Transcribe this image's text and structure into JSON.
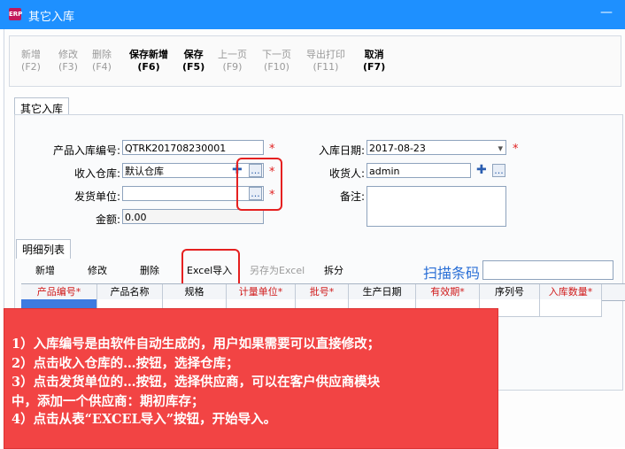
{
  "window": {
    "title": "其它入库",
    "app_icon": "app-logo-icon",
    "minimize_glyph": "—"
  },
  "toolbar": [
    {
      "label": "新增",
      "key": "(F2)",
      "enabled": false
    },
    {
      "label": "修改",
      "key": "(F3)",
      "enabled": false
    },
    {
      "label": "删除",
      "key": "(F4)",
      "enabled": false
    },
    {
      "label": "保存新增",
      "key": "(F6)",
      "enabled": true
    },
    {
      "label": "保存",
      "key": "(F5)",
      "enabled": true
    },
    {
      "label": "上一页",
      "key": "(F9)",
      "enabled": false
    },
    {
      "label": "下一页",
      "key": "(F10)",
      "enabled": false
    },
    {
      "label": "导出打印",
      "key": "(F11)",
      "enabled": false
    },
    {
      "label": "取消",
      "key": "(F7)",
      "enabled": true
    }
  ],
  "tab_main": "其它入库",
  "form": {
    "product_code_label": "产品入库编号:",
    "product_code_value": "QTRK201708230001",
    "warehouse_label": "收入仓库:",
    "warehouse_value": "默认仓库",
    "supplier_label": "发货单位:",
    "supplier_value": "",
    "amount_label": "金额:",
    "amount_value": "0.00",
    "date_label": "入库日期:",
    "date_value": "2017-08-23",
    "receiver_label": "收货人:",
    "receiver_value": "admin",
    "remark_label": "备注:",
    "remark_value": "",
    "required_mark": "*",
    "ellipsis": "...",
    "plus": "✚",
    "calendar_dropdown": "▾"
  },
  "detail": {
    "tab": "明细列表",
    "buttons": [
      {
        "label": "新增",
        "enabled": true
      },
      {
        "label": "修改",
        "enabled": true
      },
      {
        "label": "删除",
        "enabled": true
      },
      {
        "label": "Excel导入",
        "enabled": true
      },
      {
        "label": "另存为Excel",
        "enabled": false
      },
      {
        "label": "拆分",
        "enabled": true
      }
    ],
    "scan_label": "扫描条码",
    "columns": [
      {
        "label": "产品编号*",
        "required": true
      },
      {
        "label": "产品名称",
        "required": false
      },
      {
        "label": "规格",
        "required": false
      },
      {
        "label": "计量单位*",
        "required": true
      },
      {
        "label": "批号*",
        "required": true
      },
      {
        "label": "生产日期",
        "required": false
      },
      {
        "label": "有效期*",
        "required": true
      },
      {
        "label": "序列号",
        "required": false
      },
      {
        "label": "入库数量*",
        "required": true
      }
    ]
  },
  "note": {
    "lines": [
      "1）入库编号是由软件自动生成的，用户如果需要可以直接修改；",
      "2）点击收入仓库的…按钮，选择仓库；",
      "3）点击发货单位的…按钮，选择供应商，可以在客户供应商模块",
      "中，添加一个供应商：期初库存；",
      "4）点击从表“EXCEL导入”按钮，开始导入。"
    ]
  },
  "colors": {
    "titlebar": "#1e90ff",
    "note_bg": "#f24444",
    "highlight": "#e52020",
    "required": "#d01919"
  }
}
